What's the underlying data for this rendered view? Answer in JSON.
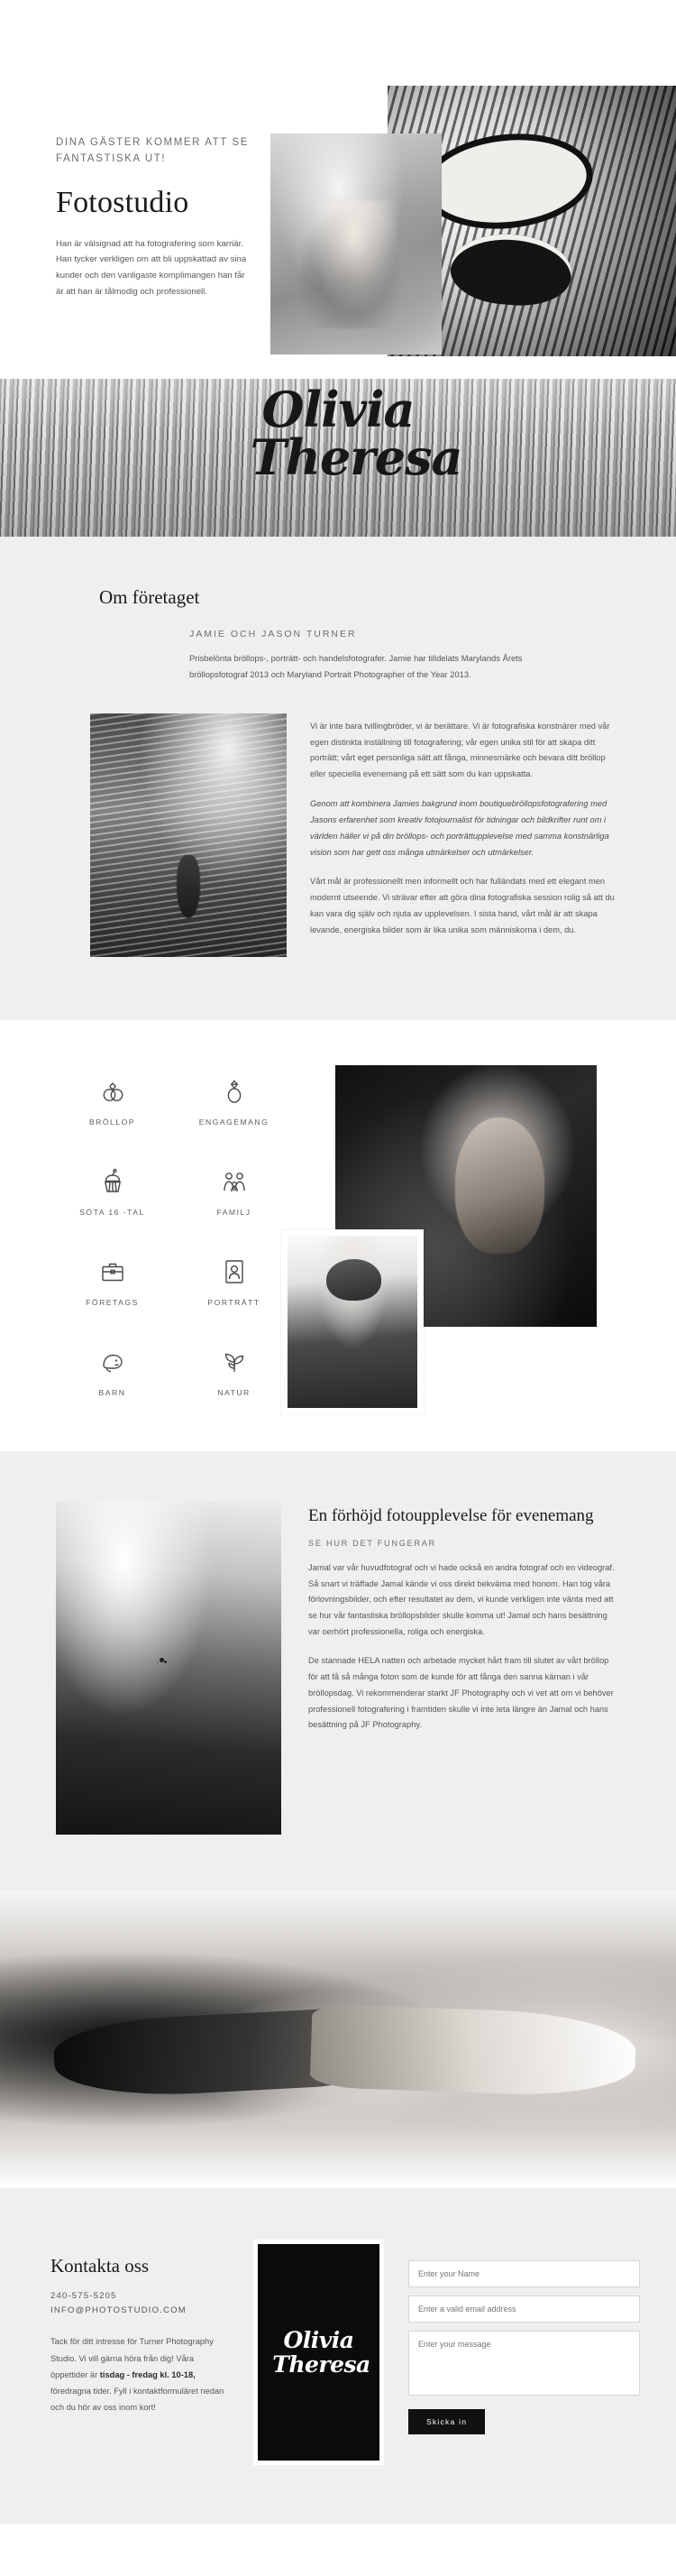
{
  "hero": {
    "eyebrow": "DINA GÄSTER KOMMER ATT SE FANTASTISKA UT!",
    "title": "Fotostudio",
    "paragraph": "Han är välsignad att ha fotografering som karriär. Han tycker verkligen om att bli uppskattad av sina kunder och den vanligaste komplimangen han får är att han är tålmodig och professionell.",
    "image_main": "portrait-photo",
    "image_accent": "mural-photo"
  },
  "signature": {
    "line1": "Olivia",
    "line2": "Theresa"
  },
  "about": {
    "title": "Om företaget",
    "subtitle": "JAMIE OCH JASON TURNER",
    "lead": "Prisbelönta bröllops-, porträtt- och handelsfotografer. Jamie har tilldelats Marylands Årets bröllopsfotograf 2013 och Maryland Portrait Photographer of the Year 2013.",
    "photo": "underwater-photo",
    "paragraphs": [
      {
        "text": "Vi är inte bara tvillingbröder, vi är berättare. Vi är fotografiska konstnärer med vår egen distinkta inställning till fotografering; vår egen unika stil för att skapa ditt porträtt; vårt eget personliga sätt att fånga, minnesmärke och bevara ditt bröllop eller speciella evenemang på ett sätt som du kan uppskatta.",
        "emphasis": false
      },
      {
        "text": "Genom att kombinera Jamies bakgrund inom boutiquebröllopsfotografering med Jasons erfarenhet som kreativ fotojournalist för tidningar och bildkrifter runt om i världen häller vi på din bröllops- och porträttupplevelse med samma konstnärliga vision som har gett oss många utmärkelser och utmärkelser.",
        "emphasis": true
      },
      {
        "text": "Vårt mål är professionellt men informellt och har fulländats med ett elegant men modernt utseende. Vi strävar efter att göra dina fotografiska session rolig så att du kan vara dig själv och njuta av upplevelsen. I sista hand, vårt mål är att skapa levande, energiska bilder som är lika unika som människorna i dem, du.",
        "emphasis": false
      }
    ]
  },
  "services": {
    "items": [
      {
        "label": "BRÖLLOP",
        "icon": "wedding-rings-icon"
      },
      {
        "label": "ENGAGEMANG",
        "icon": "engagement-ring-icon"
      },
      {
        "label": "SÖTA 16 -TAL",
        "icon": "cupcake-icon"
      },
      {
        "label": "FAMILJ",
        "icon": "family-icon"
      },
      {
        "label": "FÖRETAGS",
        "icon": "briefcase-icon"
      },
      {
        "label": "PORTRÄTT",
        "icon": "portrait-frame-icon"
      },
      {
        "label": "BARN",
        "icon": "baby-icon"
      },
      {
        "label": "NATUR",
        "icon": "leaf-icon"
      }
    ],
    "image_dark": "profile-photo",
    "image_light": "beanie-portrait-photo"
  },
  "experience": {
    "title": "En förhöjd fotoupplevelse för evenemang",
    "subtitle": "SE HUR DET FUNGERAR",
    "photo": "bird-landscape-photo",
    "paragraphs": [
      "Jamal var vår huvudfotograf och vi hade också en andra fotograf och en videograf. Så snart vi träffade Jamal kände vi oss direkt bekväma med honom. Han tog våra förlovningsbilder, och efter resultatet av dem, vi kunde verkligen inte vänta med att se hur vår fantastiska bröllopsbilder skulle komma ut! Jamal och hans besättning var oerhört professionella, roliga och energiska.",
      "De stannade HELA natten och arbetade mycket hårt fram till slutet av vårt bröllop för att få så många foton som de kunde för att fånga den sanna kärnan i vår bröllopsdag. Vi rekommenderar starkt JF Photography och vi vet att om vi behöver professionell fotografering i framtiden skulle vi inte leta längre än Jamal och hans besättning på JF Photography."
    ]
  },
  "hands_banner": {
    "image": "handshake-photo"
  },
  "contact": {
    "title": "Kontakta oss",
    "phone": "240-575-5205",
    "email": "INFO@PHOTOSTUDIO.COM",
    "body_prefix": "Tack för ditt intresse för Turner Photography Studio. Vi vill gärna höra från dig! Våra öppettider är ",
    "body_bold": "tisdag - fredag kl. 10-18,",
    "body_suffix": " föredragna tider. Fyll i kontaktformuläret nedan och du hör av oss inom kort!",
    "card_line1": "Olivia",
    "card_line2": "Theresa",
    "form": {
      "name_placeholder": "Enter your Name",
      "email_placeholder": "Enter a valid email address",
      "message_placeholder": "Enter your message",
      "submit_label": "Skicka in"
    }
  },
  "colors": {
    "page_bg": "#ffffff",
    "section_bg": "#efefef",
    "ink": "#1b1b1b",
    "muted": "#565656",
    "button_bg": "#111111"
  }
}
